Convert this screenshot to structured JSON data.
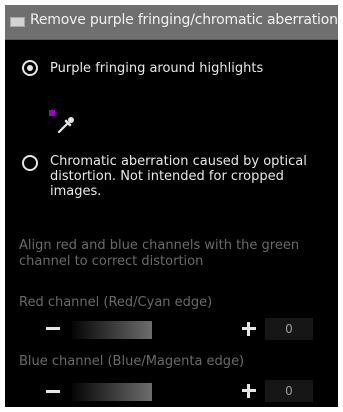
{
  "header": {
    "title": "Remove purple fringing/chromatic aberration"
  },
  "options": [
    {
      "label": "Purple fringing around highlights",
      "selected": true
    },
    {
      "label_lines": [
        "Chromatic aberration caused by optical",
        "distortion. Not intended for cropped",
        "images."
      ],
      "selected": false
    }
  ],
  "tool": {
    "swatch_color": "#9b00c8",
    "icon": "eyedropper-icon"
  },
  "info": "Align red and blue channels with the green channel to correct distortion",
  "sliders": [
    {
      "label": "Red channel (Red/Cyan edge)",
      "value": "0"
    },
    {
      "label": "Blue channel (Blue/Magenta edge)",
      "value": "0"
    }
  ]
}
